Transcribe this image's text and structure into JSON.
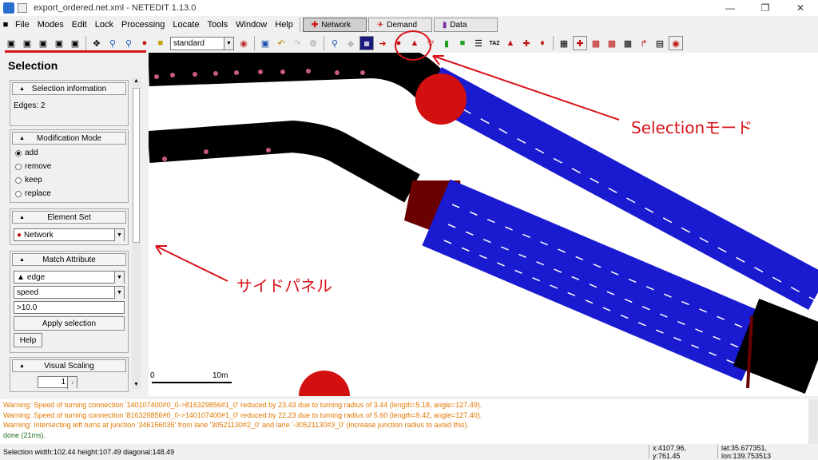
{
  "window": {
    "title": "export_ordered.net.xml - NETEDIT 1.13.0"
  },
  "menu": [
    "File",
    "Modes",
    "Edit",
    "Lock",
    "Processing",
    "Locate",
    "Tools",
    "Window",
    "Help"
  ],
  "supermodes": [
    {
      "label": "Network",
      "active": true
    },
    {
      "label": "Demand",
      "active": false
    },
    {
      "label": "Data",
      "active": false
    }
  ],
  "toolbar": {
    "viewport_scheme": "standard"
  },
  "side_panel": {
    "title": "Selection",
    "info": {
      "header": "Selection information",
      "text": "Edges: 2"
    },
    "modification": {
      "header": "Modification Mode",
      "options": [
        "add",
        "remove",
        "keep",
        "replace"
      ],
      "selected": "add"
    },
    "element_set": {
      "header": "Element Set",
      "value": "Network"
    },
    "match_attribute": {
      "header": "Match Attribute",
      "element": "edge",
      "attribute": "speed",
      "expression": ">10.0",
      "apply_label": "Apply selection",
      "help_label": "Help"
    },
    "visual_scaling": {
      "header": "Visual Scaling",
      "value": "1"
    }
  },
  "scale_bar": {
    "start": "0",
    "end": "10m"
  },
  "messages": [
    {
      "type": "warning",
      "text": "Warning: Speed of turning connection '140107400#0_0->816329856#1_0' reduced by 23.43 due to turning radius of 3.44 (length=5.18, angle=127.49)."
    },
    {
      "type": "warning",
      "text": "Warning: Speed of turning connection '816329856#0_0->140107400#1_0' reduced by 22.23 due to turning radius of 5.60 (length=9.42, angle=127.40)."
    },
    {
      "type": "warning",
      "text": "Warning: Intersecting left turns at junction '346156035' from lane '30521130#2_0' and lane '-30521130#3_0' (increase junction radius to avoid this)."
    },
    {
      "type": "ok",
      "text": "done (21ms)."
    }
  ],
  "statusbar": {
    "selection": "Selection width:102.44 height:107.49 diagonal:148.49",
    "coords": "x:4107.96, y:761.45",
    "geo": "lat:35.677351, lon:139.753513"
  },
  "annotations": {
    "mode_label": "Selectionモード",
    "panel_label": "サイドパネル"
  },
  "colors": {
    "annotation": "#d8141a",
    "selected_edge": "#1a1ad0",
    "road": "#000000",
    "junction": "#6a0000"
  }
}
